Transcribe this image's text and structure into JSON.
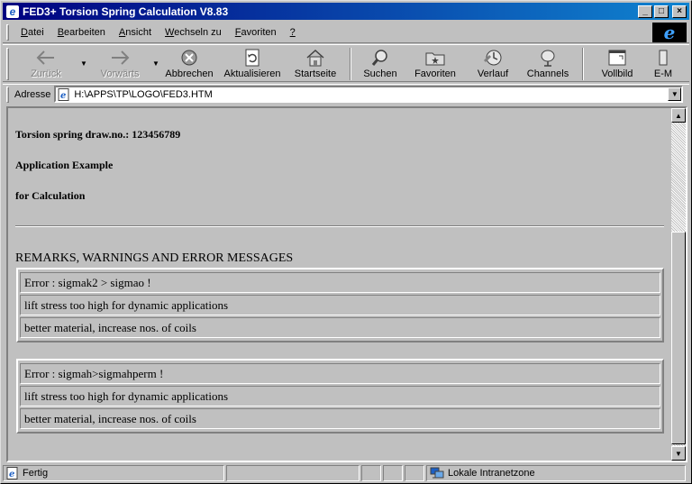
{
  "window": {
    "title": "FED3+ Torsion Spring Calculation V8.83",
    "min_glyph": "_",
    "max_glyph": "□",
    "close_glyph": "×"
  },
  "menu": [
    {
      "underline": "D",
      "rest": "atei"
    },
    {
      "underline": "B",
      "rest": "earbeiten"
    },
    {
      "underline": "A",
      "rest": "nsicht"
    },
    {
      "underline": "W",
      "rest": "echseln zu"
    },
    {
      "underline": "F",
      "rest": "avoriten"
    },
    {
      "underline": "?",
      "rest": ""
    }
  ],
  "toolbar": {
    "back": "Zurück",
    "forward": "Vorwärts",
    "stop": "Abbrechen",
    "refresh": "Aktualisieren",
    "home": "Startseite",
    "search": "Suchen",
    "favorites": "Favoriten",
    "history": "Verlauf",
    "channels": "Channels",
    "fullscreen": "Vollbild",
    "mail": "E-M"
  },
  "address": {
    "label": "Adresse",
    "value": "H:\\APPS\\TP\\LOGO\\FED3.HTM"
  },
  "page": {
    "draw_no": "Torsion spring draw.no.: 123456789",
    "line2": "Application Example",
    "line3": "for Calculation",
    "section_title": "REMARKS, WARNINGS AND ERROR MESSAGES",
    "messages": [
      {
        "error": "Error : sigmak2 > sigmao !",
        "detail": "lift stress too high for dynamic applications",
        "advice": "better material, increase nos. of coils"
      },
      {
        "error": "Error : sigmah>sigmahperm !",
        "detail": "lift stress too high for dynamic applications",
        "advice": "better material, increase nos. of coils"
      }
    ]
  },
  "status": {
    "text": "Fertig",
    "zone": "Lokale Intranetzone"
  }
}
